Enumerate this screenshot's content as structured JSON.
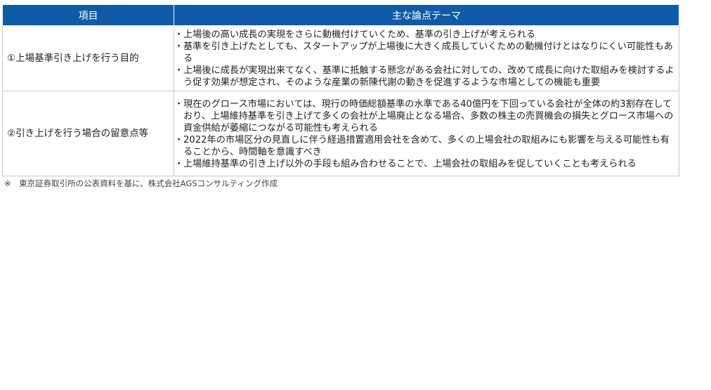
{
  "table": {
    "headers": {
      "item": "項目",
      "theme": "主な論点テーマ"
    },
    "rows": [
      {
        "topic": "①上場基準引き上げを行う目的",
        "points": [
          "上場後の高い成長の実現をさらに動機付けていくため、基準の引き上げが考えられる",
          "基準を引き上げたとしても、スタートアップが上場後に大きく成長していくための動機付けとはなりにくい可能性もある",
          "上場後に成長が実現出来てなく、基準に抵触する懸念がある会社に対しての、改めて成長に向けた取組みを検討するよう促す効果が想定され、そのような産業の新陳代謝の動きを促進するような市場としての機能も重要"
        ]
      },
      {
        "topic": "②引き上げを行う場合の留意点等",
        "points": [
          "現在のグロース市場においては、現行の時価総額基準の水準である40億円を下回っている会社が全体の約3割存在しており、上場維持基準を引き上げて多くの会社が上場廃止となる場合、多数の株主の売買機会の損失とグロース市場への資金供給が萎縮につながる可能性も考えられる",
          "2022年の市場区分の見直しに伴う経過措置適用会社を含めて、多くの上場会社の取組みにも影響を与える可能性も有ることから、時間軸を意識すべき",
          "上場維持基準の引き上げ以外の手段も組み合わせることで、上場会社の取組みを促していくことも考えられる"
        ]
      }
    ]
  },
  "footnote": "※　東京証券取引所の公表資料を基に、株式会社AGSコンサルティング作成",
  "colors": {
    "header_bg": "#0f5ba7",
    "header_text": "#ffffff",
    "border": "#c8c8c8"
  }
}
